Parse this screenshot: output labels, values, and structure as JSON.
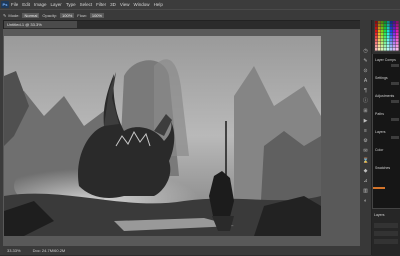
{
  "app": {
    "logo_text": "Ps"
  },
  "menubar": {
    "items": [
      "File",
      "Edit",
      "Image",
      "Layer",
      "Type",
      "Select",
      "Filter",
      "3D",
      "View",
      "Window",
      "Help"
    ]
  },
  "optionsbar": {
    "mode_label": "Mode:",
    "mode_value": "Normal",
    "opacity_label": "Opacity:",
    "opacity_value": "100%",
    "flow_label": "Flow:",
    "flow_value": "100%"
  },
  "document": {
    "tab_label": "Untitled-1 @ 33.3%"
  },
  "statusbar": {
    "zoom": "33.33%",
    "info": "Doc: 24.7M/60.2M"
  },
  "adjustments": {
    "items": [
      "Layer Comps",
      "Settings",
      "Adjustments",
      "Paths",
      "Layers",
      "Color",
      "Swatches"
    ]
  },
  "layers": {
    "label": "Layers"
  },
  "colors": {
    "accent_orange": "#d4742a",
    "panel_bg": "#161616",
    "ui_dark": "#3a3a3a"
  }
}
